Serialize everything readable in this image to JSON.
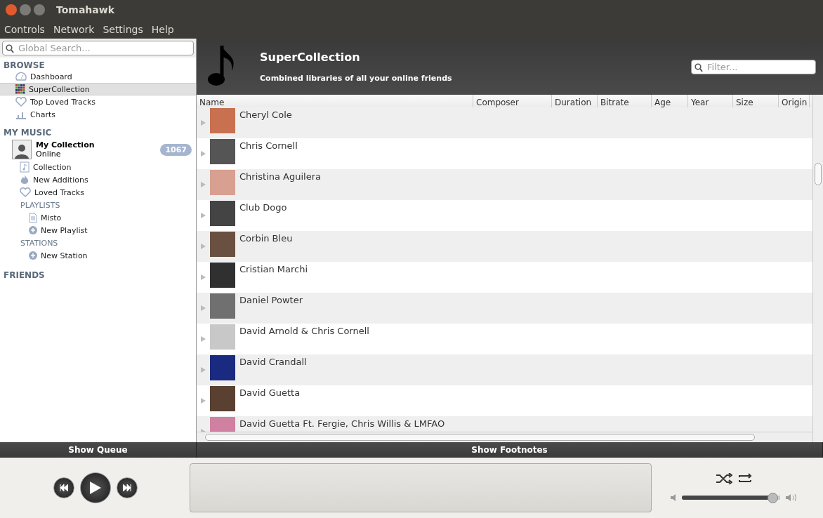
{
  "window": {
    "title": "Tomahawk"
  },
  "menu": [
    "Controls",
    "Network",
    "Settings",
    "Help"
  ],
  "search": {
    "placeholder": "Global Search..."
  },
  "browse": {
    "heading": "BROWSE",
    "items": [
      {
        "label": "Dashboard",
        "kind": "dashboard",
        "selected": false
      },
      {
        "label": "SuperCollection",
        "kind": "grid",
        "selected": true
      },
      {
        "label": "Top Loved Tracks",
        "kind": "heart",
        "selected": false
      },
      {
        "label": "Charts",
        "kind": "chart",
        "selected": false
      }
    ]
  },
  "my_music": {
    "heading": "MY MUSIC",
    "collection": {
      "name": "My Collection",
      "status": "Online",
      "count": "1067"
    },
    "items": [
      {
        "label": "Collection",
        "kind": "note"
      },
      {
        "label": "New Additions",
        "kind": "flame"
      },
      {
        "label": "Loved Tracks",
        "kind": "heart"
      }
    ],
    "playlists": {
      "heading": "PLAYLISTS",
      "items": [
        {
          "label": "Misto",
          "kind": "doc"
        },
        {
          "label": "New Playlist",
          "kind": "plus"
        }
      ]
    },
    "stations": {
      "heading": "STATIONS",
      "items": [
        {
          "label": "New Station",
          "kind": "plus"
        }
      ]
    }
  },
  "friends": {
    "heading": "FRIENDS"
  },
  "header": {
    "title": "SuperCollection",
    "subtitle": "Combined libraries of all your online friends",
    "filter_placeholder": "Filter..."
  },
  "table": {
    "columns": [
      "Name",
      "Composer",
      "Duration",
      "Bitrate",
      "Age",
      "Year",
      "Size",
      "Origin"
    ],
    "rows": [
      {
        "name": "Cheryl Cole",
        "color": "#c87050"
      },
      {
        "name": "Chris Cornell",
        "color": "#555555"
      },
      {
        "name": "Christina Aguilera",
        "color": "#d8a090"
      },
      {
        "name": "Club Dogo",
        "color": "#444444"
      },
      {
        "name": "Corbin Bleu",
        "color": "#6a5040"
      },
      {
        "name": "Cristian Marchi",
        "color": "#303030"
      },
      {
        "name": "Daniel Powter",
        "color": "#707070"
      },
      {
        "name": "David Arnold & Chris Cornell",
        "color": "#c8c8c8"
      },
      {
        "name": "David Crandall",
        "color": "#1a2a80"
      },
      {
        "name": "David Guetta",
        "color": "#5a4030"
      },
      {
        "name": "David Guetta Ft. Fergie, Chris Willis & LMFAO",
        "color": "#d080a0"
      }
    ]
  },
  "footer": {
    "queue": "Show Queue",
    "footnotes": "Show Footnotes"
  },
  "player": {
    "volume": {
      "level": 0.92
    }
  }
}
